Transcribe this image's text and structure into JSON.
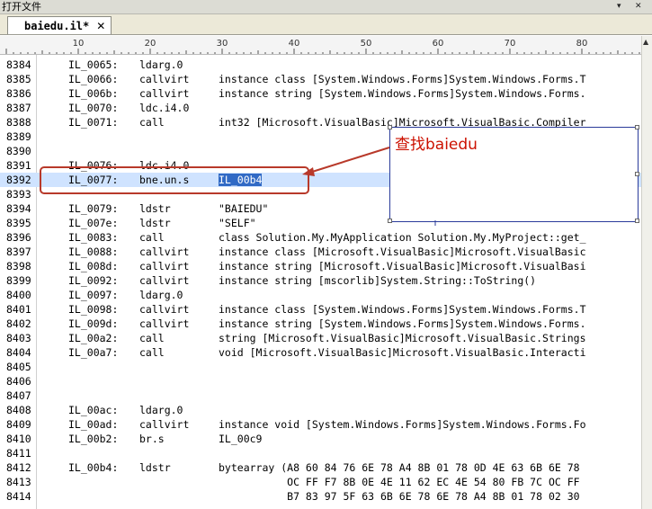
{
  "panel": {
    "title": "打开文件",
    "pin_icon": "▾",
    "close_icon": "✕"
  },
  "tab": {
    "label": "baiedu.il*",
    "close": "✕"
  },
  "ruler": {
    "labels": [
      "10",
      "20",
      "30",
      "40",
      "50",
      "60",
      "70",
      "80"
    ]
  },
  "annotation": {
    "text": "查找baiedu"
  },
  "rows": [
    {
      "ln": "8384",
      "c1": "IL_0065:",
      "c2": "ldarg.0",
      "c3": ""
    },
    {
      "ln": "8385",
      "c1": "IL_0066:",
      "c2": "callvirt",
      "c3": "instance class [System.Windows.Forms]System.Windows.Forms.T"
    },
    {
      "ln": "8386",
      "c1": "IL_006b:",
      "c2": "callvirt",
      "c3": "instance string [System.Windows.Forms]System.Windows.Forms."
    },
    {
      "ln": "8387",
      "c1": "IL_0070:",
      "c2": "ldc.i4.0",
      "c3": ""
    },
    {
      "ln": "8388",
      "c1": "IL_0071:",
      "c2": "call",
      "c3": "int32 [Microsoft.VisualBasic]Microsoft.VisualBasic.Compiler"
    },
    {
      "ln": "8389",
      "c1": "",
      "c2": "",
      "c3": ""
    },
    {
      "ln": "8390",
      "c1": "",
      "c2": "",
      "c3": ""
    },
    {
      "ln": "8391",
      "c1": "IL_0076:",
      "c2": "ldc.i4.0",
      "c3": ""
    },
    {
      "ln": "8392",
      "c1": "IL_0077:",
      "c2": "bne.un.s",
      "c3": "IL_00b4"
    },
    {
      "ln": "8393",
      "c1": "",
      "c2": "",
      "c3": ""
    },
    {
      "ln": "8394",
      "c1": "IL_0079:",
      "c2": "ldstr",
      "c3": "\"BAIEDU\""
    },
    {
      "ln": "8395",
      "c1": "IL_007e:",
      "c2": "ldstr",
      "c3": "\"SELF\""
    },
    {
      "ln": "8396",
      "c1": "IL_0083:",
      "c2": "call",
      "c3": "class Solution.My.MyApplication Solution.My.MyProject::get_"
    },
    {
      "ln": "8397",
      "c1": "IL_0088:",
      "c2": "callvirt",
      "c3": "instance class [Microsoft.VisualBasic]Microsoft.VisualBasic"
    },
    {
      "ln": "8398",
      "c1": "IL_008d:",
      "c2": "callvirt",
      "c3": "instance string [Microsoft.VisualBasic]Microsoft.VisualBasi"
    },
    {
      "ln": "8399",
      "c1": "IL_0092:",
      "c2": "callvirt",
      "c3": "instance string [mscorlib]System.String::ToString()"
    },
    {
      "ln": "8400",
      "c1": "IL_0097:",
      "c2": "ldarg.0",
      "c3": ""
    },
    {
      "ln": "8401",
      "c1": "IL_0098:",
      "c2": "callvirt",
      "c3": "instance class [System.Windows.Forms]System.Windows.Forms.T"
    },
    {
      "ln": "8402",
      "c1": "IL_009d:",
      "c2": "callvirt",
      "c3": "instance string [System.Windows.Forms]System.Windows.Forms."
    },
    {
      "ln": "8403",
      "c1": "IL_00a2:",
      "c2": "call",
      "c3": "string [Microsoft.VisualBasic]Microsoft.VisualBasic.Strings"
    },
    {
      "ln": "8404",
      "c1": "IL_00a7:",
      "c2": "call",
      "c3": "void [Microsoft.VisualBasic]Microsoft.VisualBasic.Interacti"
    },
    {
      "ln": "8405",
      "c1": "",
      "c2": "",
      "c3": ""
    },
    {
      "ln": "8406",
      "c1": "",
      "c2": "",
      "c3": ""
    },
    {
      "ln": "8407",
      "c1": "",
      "c2": "",
      "c3": ""
    },
    {
      "ln": "8408",
      "c1": "IL_00ac:",
      "c2": "ldarg.0",
      "c3": ""
    },
    {
      "ln": "8409",
      "c1": "IL_00ad:",
      "c2": "callvirt",
      "c3": "instance void [System.Windows.Forms]System.Windows.Forms.Fo"
    },
    {
      "ln": "8410",
      "c1": "IL_00b2:",
      "c2": "br.s",
      "c3": "IL_00c9"
    },
    {
      "ln": "8411",
      "c1": "",
      "c2": "",
      "c3": ""
    },
    {
      "ln": "8412",
      "c1": "IL_00b4:",
      "c2": "ldstr",
      "c3": "bytearray (A8 60 84 76 6E 78 A4 8B 01 78 0D 4E 63 6B 6E 78"
    },
    {
      "ln": "8413",
      "c1": "",
      "c2": "",
      "c3": "           OC FF F7 8B 0E 4E 11 62 EC 4E 54 80 FB 7C OC FF"
    },
    {
      "ln": "8414",
      "c1": "",
      "c2": "",
      "c3": "           B7 83 97 5F 63 6B 6E 78 6E 78 A4 8B 01 78 02 30"
    }
  ],
  "highlight_row": "8392",
  "selected_text": "IL_00b4"
}
